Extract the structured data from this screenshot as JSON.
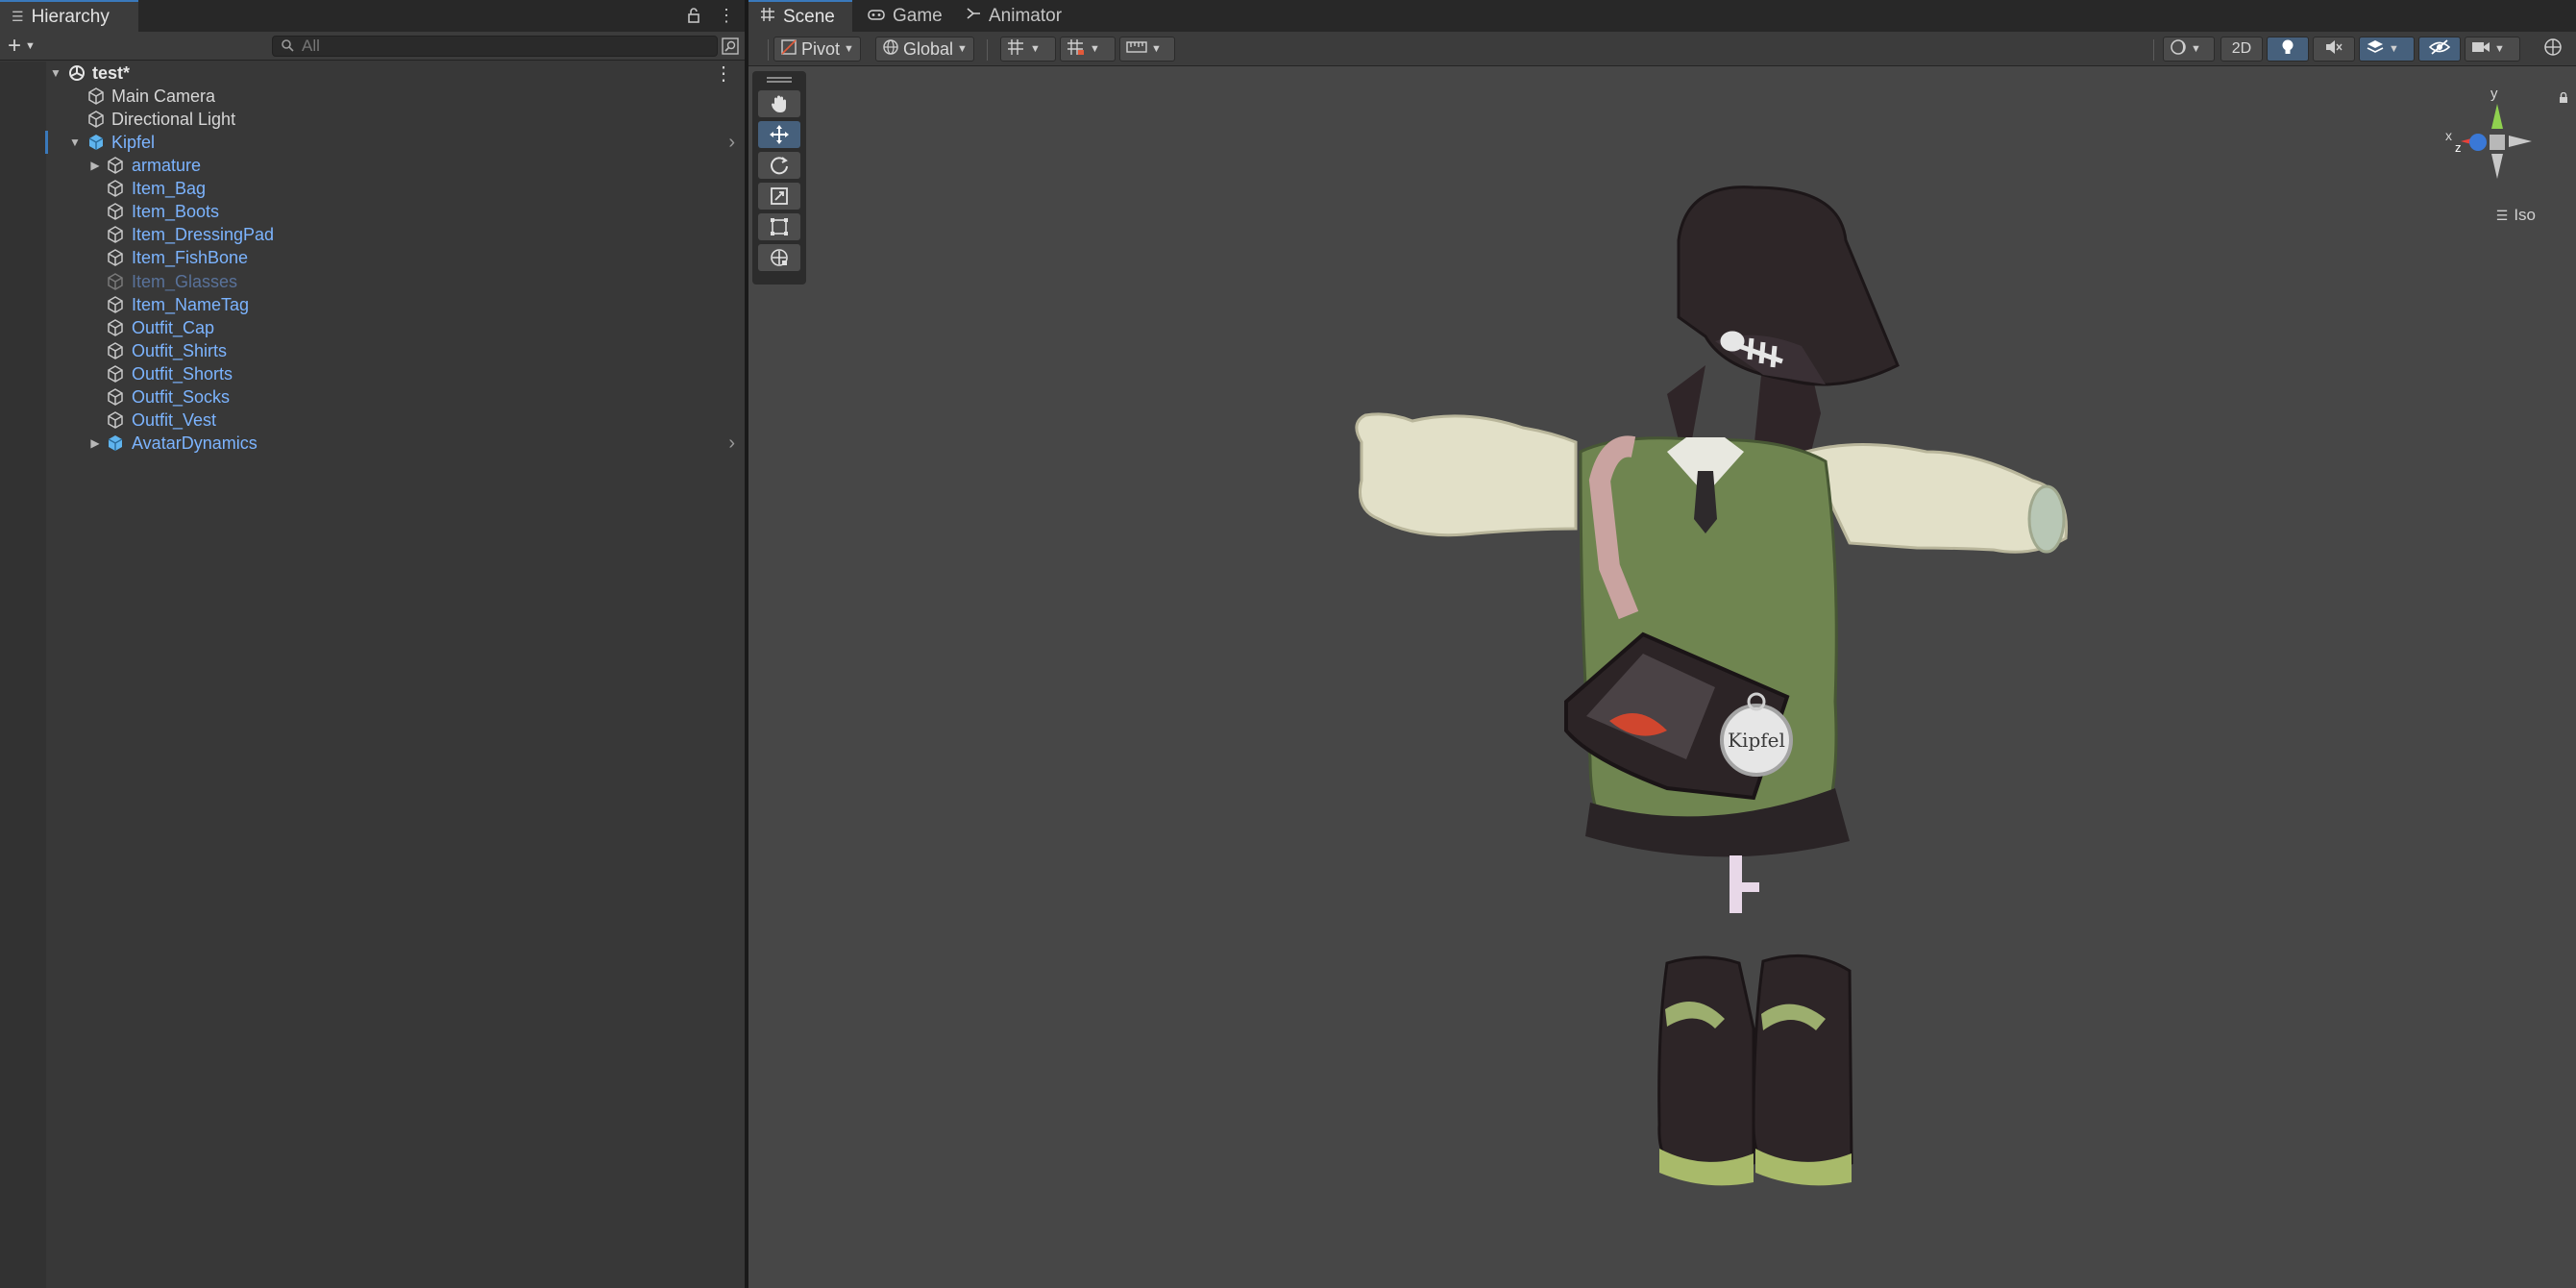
{
  "hierarchy": {
    "tab_label": "Hierarchy",
    "search_placeholder": "All",
    "scene_name": "test*",
    "items": [
      {
        "label": "Main Camera"
      },
      {
        "label": "Directional Light"
      },
      {
        "label": "Kipfel"
      },
      {
        "label": "armature"
      },
      {
        "label": "Item_Bag"
      },
      {
        "label": "Item_Boots"
      },
      {
        "label": "Item_DressingPad"
      },
      {
        "label": "Item_FishBone"
      },
      {
        "label": "Item_Glasses"
      },
      {
        "label": "Item_NameTag"
      },
      {
        "label": "Outfit_Cap"
      },
      {
        "label": "Outfit_Shirts"
      },
      {
        "label": "Outfit_Shorts"
      },
      {
        "label": "Outfit_Socks"
      },
      {
        "label": "Outfit_Vest"
      },
      {
        "label": "AvatarDynamics"
      }
    ]
  },
  "scene": {
    "tabs": [
      {
        "label": "Scene",
        "icon": "scene-grid-icon"
      },
      {
        "label": "Game",
        "icon": "gamepad-icon"
      },
      {
        "label": "Animator",
        "icon": "animator-icon"
      }
    ],
    "toolbar": {
      "pivot_label": "Pivot",
      "global_label": "Global",
      "mode_2d_label": "2D"
    },
    "gizmo": {
      "y_label": "y",
      "x_label": "x",
      "z_label": "z",
      "projection_label": "Iso"
    },
    "nametag_text": "Kipfel"
  },
  "colors": {
    "accent": "#3a79bb",
    "prefab_blue": "#7cb4ff",
    "panel_bg": "#383838",
    "scene_bg": "#474747"
  }
}
